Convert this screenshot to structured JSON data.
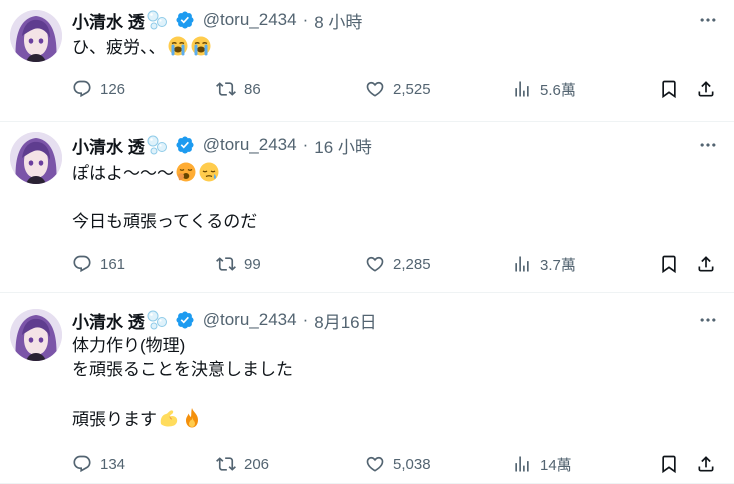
{
  "tweets": [
    {
      "name": "小清水 透",
      "handle": "@toru_2434",
      "separator": "·",
      "time": "8 小時",
      "lines": [
        "ひ、疲労、、"
      ],
      "emojis": [
        "loudly-crying-face",
        "loudly-crying-face"
      ],
      "stats": {
        "replies": "126",
        "retweets": "86",
        "likes": "2,525",
        "views": "5.6萬"
      }
    },
    {
      "name": "小清水 透",
      "handle": "@toru_2434",
      "separator": "·",
      "time": "16 小時",
      "lines": [
        "ぽはよ〜〜〜",
        "今日も頑張ってくるのだ"
      ],
      "emojis": [
        "yawning-face",
        "sleepy-face"
      ],
      "stats": {
        "replies": "161",
        "retweets": "99",
        "likes": "2,285",
        "views": "3.7萬"
      }
    },
    {
      "name": "小清水 透",
      "handle": "@toru_2434",
      "separator": "·",
      "time": "8月16日",
      "lines": [
        "体力作り(物理)",
        "を頑張ることを決意しました",
        "頑張ります"
      ],
      "emojis": [
        "flexed-biceps",
        "fire"
      ],
      "stats": {
        "replies": "134",
        "retweets": "206",
        "likes": "5,038",
        "views": "14萬"
      }
    }
  ],
  "colors": {
    "verified": "#1d9bf0",
    "muted": "#536471",
    "text": "#0f1419",
    "divider": "#eff3f4"
  }
}
